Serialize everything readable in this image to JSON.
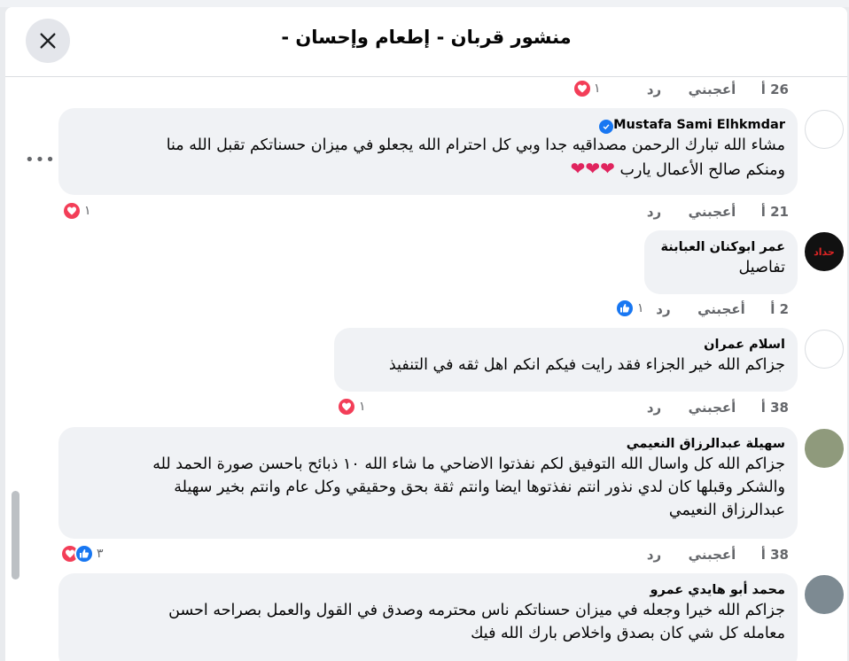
{
  "header": {
    "title": "منشور قربان - إطعام وإحسان -"
  },
  "top_meta": {
    "time": "26 أ",
    "like": "أعجبني",
    "reply": "رد",
    "react_count": "١"
  },
  "comments": [
    {
      "author": "Mustafa Sami Elhkmdar",
      "verified": true,
      "lines": [
        "مشاء الله تبارك الرحمن مصداقيه جدا وبي كل احترام الله يجعلو في ميزان حسناتكم تقبل الله منا",
        "ومنكم صالح الأعمال يارب"
      ],
      "emoji": "❤❤❤",
      "time": "21 أ",
      "like": "أعجبني",
      "reply": "رد",
      "react_count": "١"
    },
    {
      "author": "عمر ابوكنان العبابنة",
      "lines": [
        "تفاصيل"
      ],
      "avatar_text": "حداد",
      "time": "2 أ",
      "like": "أعجبني",
      "reply": "رد",
      "react_count": "١"
    },
    {
      "author": "اسلام عمران",
      "lines": [
        "جزاكم الله خير الجزاء فقد رايت فيكم انكم اهل ثقه في التنفيذ"
      ],
      "time": "38 أ",
      "like": "أعجبني",
      "reply": "رد",
      "react_count": "١"
    },
    {
      "author": "سهيلة عبدالرزاق النعيمي",
      "lines": [
        "جزاكم الله كل واسال الله التوفيق لكم نفذتوا الاضاحي ما شاء الله ١٠ ذبائح باحسن صورة الحمد لله",
        "والشكر وقبلها كان لدي نذور انتم نفذتوها ايضا وانتم ثقة بحق وحقيقي وكل عام وانتم بخير سهيلة",
        "عبدالرزاق النعيمي"
      ],
      "time": "38 أ",
      "like": "أعجبني",
      "reply": "رد",
      "react_count": "٣"
    },
    {
      "author": "محمد أبو هايدي عمرو",
      "lines": [
        "جزاكم الله خيرا وجعله في ميزان حسناتكم ناس محترمه وصدق في القول والعمل بصراحه احسن",
        "معامله كل شي كان بصدق واخلاص بارك الله فيك"
      ]
    }
  ],
  "colors": {
    "heart": "#f33e58",
    "like": "#1877f2",
    "bubble": "#f0f2f5",
    "meta": "#65676b"
  },
  "icons": [
    "close-icon",
    "heart-reaction-icon",
    "like-reaction-icon",
    "verified-badge-icon",
    "more-options-icon"
  ]
}
